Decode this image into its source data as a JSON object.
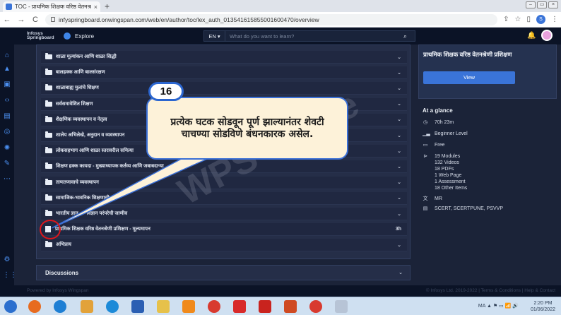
{
  "browser": {
    "tab_title": "TOC - प्राथमिक शिक्षक वरिष्ठ वेतनश्र...",
    "tab_close": "×",
    "new_tab": "+",
    "url": "infyspringboard.onwingspan.com/web/en/author/toc/lex_auth_013541615855001600470/overview",
    "back": "←",
    "forward": "→",
    "reload": "C",
    "user_initial": "S"
  },
  "header": {
    "logo": "Infosys Springboard",
    "explore": "Explore",
    "lang": "EN ▾",
    "search_placeholder": "What do you want to learn?",
    "bell": "🔔"
  },
  "toc": {
    "rows": [
      {
        "label": "शाळा मूल्यांकन आणि शाळा सिद्धी",
        "icon": "folder"
      },
      {
        "label": "बालहक्क आणि बालसंरक्षण",
        "icon": "folder"
      },
      {
        "label": "शाळाबाह्य मुलांचे शिक्षण",
        "icon": "folder"
      },
      {
        "label": "सर्वसमावेशित शिक्षण",
        "icon": "folder"
      },
      {
        "label": "शैक्षणिक व्यवस्थापन व नेतृत्व",
        "icon": "folder"
      },
      {
        "label": "शालेय अभिलेखे, अनुदान व व्यवस्थापन",
        "icon": "folder"
      },
      {
        "label": "लोकसहभाग आणि शाळा स्तरावरील समित्या",
        "icon": "folder"
      },
      {
        "label": "शिक्षण हक्क कायदा - मुख्याध्यापक कर्तव्य आणि जबाबदाऱ्या",
        "icon": "folder"
      },
      {
        "label": "ताणतणावाचे व्यवस्थापन",
        "icon": "folder"
      },
      {
        "label": "सामाजिक-भावनिक शिक्षणाची",
        "icon": "folder"
      },
      {
        "label": "भारतीय ज्ञान... - विज्ञान परंपरेची जाणीव",
        "icon": "folder"
      },
      {
        "label": "प्राथमिक शिक्षक वरिष्ठ वेतनश्रेणी प्रशिक्षण - मूल्यमापन",
        "icon": "doc",
        "duration": "3h"
      },
      {
        "label": "अभिप्राय",
        "icon": "folder"
      }
    ],
    "chevron": "⌄"
  },
  "discussions": {
    "label": "Discussions"
  },
  "course_card": {
    "title": "प्राथमिक शिक्षक वरिष्ठ वेतनश्रेणी प्रशिक्षण",
    "view": "View"
  },
  "glance": {
    "heading": "At a glance",
    "duration": "70h 23m",
    "level": "Beginner Level",
    "price": "Free",
    "modules": "19 Modules",
    "videos": "132 Videos",
    "pdfs": "18 PDFs",
    "webpage": "1 Web Page",
    "assessment": "1 Assessment",
    "other": "18 Other Items",
    "language": "MR",
    "source": "SCERT, SCERTPUNE, PSVVP"
  },
  "footer": {
    "left": "Powered by Infosys Wingspan",
    "right": "© Infosys Ltd. 2019-2022 | Terms & Conditions | Help & Contact"
  },
  "annotation": {
    "step": "16",
    "text": "प्रत्येक घटक सोडवून पूर्ण झाल्यानंतर शेवटी चाचण्या सोडविणे बंधनकारक असेल.",
    "watermark": "WPS Office"
  },
  "taskbar": {
    "tray": "MA ▲ ⚑ ▭ 📶 🔊",
    "time": "2:20 PM",
    "date": "01/06/2022"
  },
  "colors": {
    "accent": "#3a74d8",
    "callout_border": "#2b66d0",
    "ring": "#e0161b",
    "bubble_bg": "#fdf2d9"
  }
}
